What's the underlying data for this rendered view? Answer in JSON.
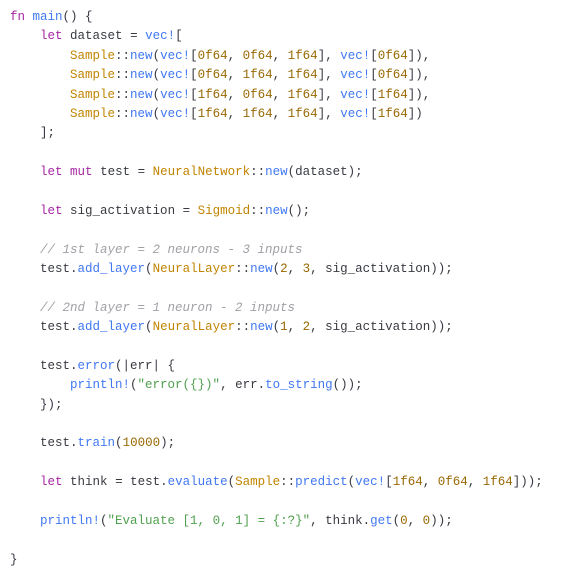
{
  "code": {
    "l1": {
      "kw_fn": "fn",
      "fn_main": "main",
      "paren": "() {"
    },
    "l2": {
      "kw_let": "let",
      "id_dataset": "dataset",
      "eq": " = ",
      "mc_vec": "vec!",
      "open": "["
    },
    "l3": {
      "ty": "Sample",
      "sep": "::",
      "fn": "new",
      "p1": "(",
      "mc1": "vec!",
      "b1": "[",
      "n1": "0f64",
      "c1": ", ",
      "n2": "0f64",
      "c2": ", ",
      "n3": "1f64",
      "b2": "], ",
      "mc2": "vec!",
      "b3": "[",
      "n4": "0f64",
      "b4": "]),"
    },
    "l4": {
      "ty": "Sample",
      "sep": "::",
      "fn": "new",
      "p1": "(",
      "mc1": "vec!",
      "b1": "[",
      "n1": "0f64",
      "c1": ", ",
      "n2": "1f64",
      "c2": ", ",
      "n3": "1f64",
      "b2": "], ",
      "mc2": "vec!",
      "b3": "[",
      "n4": "0f64",
      "b4": "]),"
    },
    "l5": {
      "ty": "Sample",
      "sep": "::",
      "fn": "new",
      "p1": "(",
      "mc1": "vec!",
      "b1": "[",
      "n1": "1f64",
      "c1": ", ",
      "n2": "0f64",
      "c2": ", ",
      "n3": "1f64",
      "b2": "], ",
      "mc2": "vec!",
      "b3": "[",
      "n4": "1f64",
      "b4": "]),"
    },
    "l6": {
      "ty": "Sample",
      "sep": "::",
      "fn": "new",
      "p1": "(",
      "mc1": "vec!",
      "b1": "[",
      "n1": "1f64",
      "c1": ", ",
      "n2": "1f64",
      "c2": ", ",
      "n3": "1f64",
      "b2": "], ",
      "mc2": "vec!",
      "b3": "[",
      "n4": "1f64",
      "b4": "])"
    },
    "l7": {
      "close": "];"
    },
    "l8": {
      "kw_let": "let",
      "kw_mut": "mut",
      "id": "test",
      "eq": " = ",
      "ty": "NeuralNetwork",
      "sep": "::",
      "fn": "new",
      "args": "(dataset);"
    },
    "l9": {
      "kw_let": "let",
      "id": "sig_activation",
      "eq": " = ",
      "ty": "Sigmoid",
      "sep": "::",
      "fn": "new",
      "args": "();"
    },
    "l10": {
      "cm": "// 1st layer = 2 neurons - 3 inputs"
    },
    "l11": {
      "id": "test.",
      "fn": "add_layer",
      "p1": "(",
      "ty": "NeuralLayer",
      "sep": "::",
      "fn2": "new",
      "p2": "(",
      "n1": "2",
      "c1": ", ",
      "n2": "3",
      "c2": ", sig_activation));"
    },
    "l12": {
      "cm": "// 2nd layer = 1 neuron - 2 inputs"
    },
    "l13": {
      "id": "test.",
      "fn": "add_layer",
      "p1": "(",
      "ty": "NeuralLayer",
      "sep": "::",
      "fn2": "new",
      "p2": "(",
      "n1": "1",
      "c1": ", ",
      "n2": "2",
      "c2": ", sig_activation));"
    },
    "l14": {
      "id": "test.",
      "fn": "error",
      "args": "(|err| {"
    },
    "l15": {
      "mc": "println!",
      "p1": "(",
      "st": "\"error({})\"",
      "c1": ", err.",
      "fn": "to_string",
      "p2": "());"
    },
    "l16": {
      "close": "});"
    },
    "l17": {
      "id": "test.",
      "fn": "train",
      "p1": "(",
      "n1": "10000",
      "p2": ");"
    },
    "l18": {
      "kw_let": "let",
      "id": "think",
      "eq": " = test.",
      "fn": "evaluate",
      "p1": "(",
      "ty": "Sample",
      "sep": "::",
      "fn2": "predict",
      "p2": "(",
      "mc": "vec!",
      "b1": "[",
      "n1": "1f64",
      "c1": ", ",
      "n2": "0f64",
      "c2": ", ",
      "n3": "1f64",
      "b2": "]));"
    },
    "l19": {
      "mc": "println!",
      "p1": "(",
      "st": "\"Evaluate [1, 0, 1] = {:?}\"",
      "c1": ", think.",
      "fn": "get",
      "p2": "(",
      "n1": "0",
      "c2": ", ",
      "n2": "0",
      "p3": "));"
    },
    "l20": {
      "close": "}"
    }
  }
}
